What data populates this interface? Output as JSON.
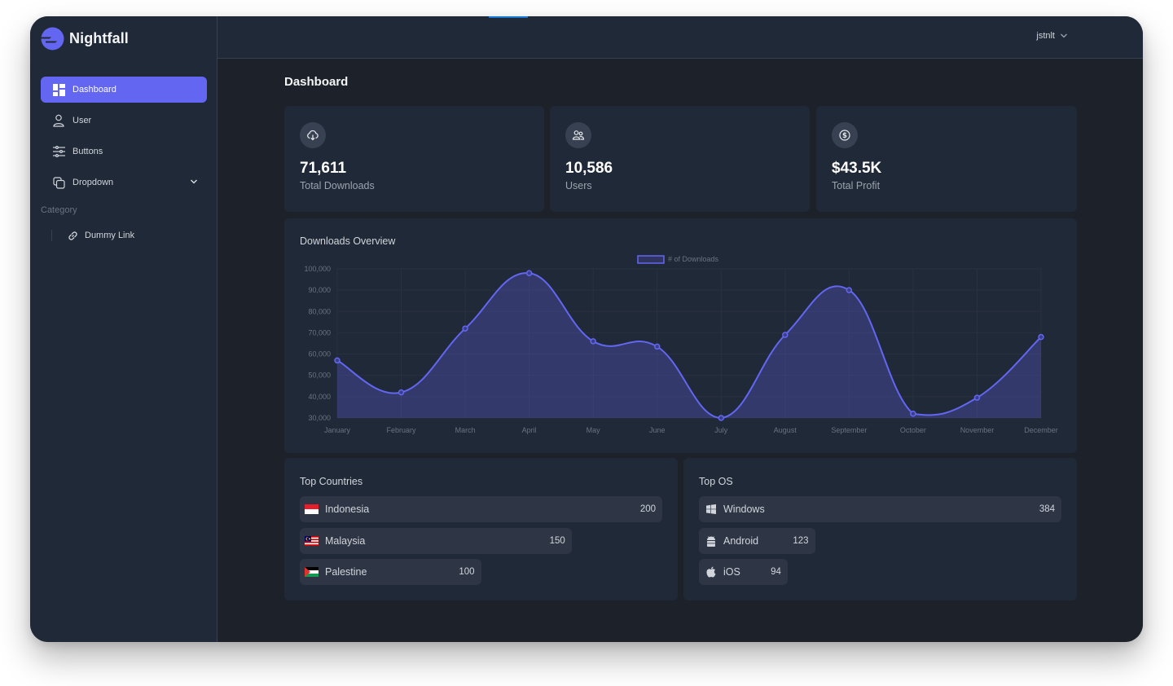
{
  "app": {
    "brand": "Nightfall",
    "accent_color": "#6366f1"
  },
  "sidebar": {
    "items": [
      {
        "label": "Dashboard",
        "icon": "dashboard-icon",
        "active": true
      },
      {
        "label": "User",
        "icon": "user-icon"
      },
      {
        "label": "Buttons",
        "icon": "sliders-icon"
      },
      {
        "label": "Dropdown",
        "icon": "copy-icon",
        "expandable": true
      }
    ],
    "category_label": "Category",
    "category_links": [
      {
        "label": "Dummy Link",
        "icon": "link-icon"
      }
    ]
  },
  "topbar": {
    "username": "jstnlt"
  },
  "page": {
    "title": "Dashboard"
  },
  "stats": [
    {
      "value": "71,611",
      "label": "Total Downloads",
      "icon": "cloud-download-icon"
    },
    {
      "value": "10,586",
      "label": "Users",
      "icon": "users-icon"
    },
    {
      "value": "$43.5K",
      "label": "Total Profit",
      "icon": "dollar-icon"
    }
  ],
  "chart_data": {
    "type": "line",
    "title": "Downloads Overview",
    "categories": [
      "January",
      "February",
      "March",
      "April",
      "May",
      "June",
      "July",
      "August",
      "September",
      "October",
      "November",
      "December"
    ],
    "series": [
      {
        "name": "# of Downloads",
        "values": [
          57000,
          42000,
          72000,
          98000,
          66000,
          63500,
          30000,
          69000,
          90000,
          32000,
          39500,
          68000
        ],
        "color": "#6366f1",
        "fill": true
      }
    ],
    "y_ticks": [
      "100,000",
      "90,000",
      "80,000",
      "70,000",
      "60,000",
      "50,000",
      "40,000",
      "30,000"
    ],
    "ylim": [
      30000,
      100000
    ],
    "y_step": 10000,
    "xlabel": "",
    "ylabel": "",
    "legend": "top-center",
    "grid": true,
    "smooth": true
  },
  "top_countries": {
    "title": "Top Countries",
    "max": 200,
    "items": [
      {
        "name": "Indonesia",
        "count": "200",
        "value": 200,
        "flag": "indonesia-flag"
      },
      {
        "name": "Malaysia",
        "count": "150",
        "value": 150,
        "flag": "malaysia-flag"
      },
      {
        "name": "Palestine",
        "count": "100",
        "value": 100,
        "flag": "palestine-flag"
      }
    ]
  },
  "top_os": {
    "title": "Top OS",
    "max": 384,
    "items": [
      {
        "name": "Windows",
        "count": "384",
        "value": 384,
        "icon": "windows-icon"
      },
      {
        "name": "Android",
        "count": "123",
        "value": 123,
        "icon": "android-icon"
      },
      {
        "name": "iOS",
        "count": "94",
        "value": 94,
        "icon": "apple-icon"
      }
    ]
  }
}
